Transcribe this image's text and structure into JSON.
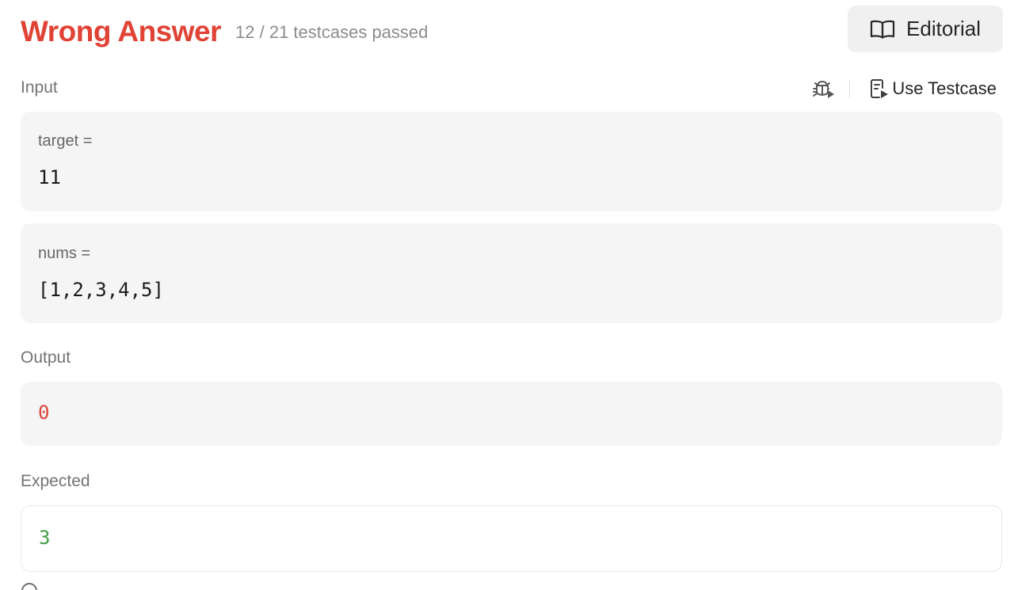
{
  "header": {
    "verdict": "Wrong Answer",
    "testcases_passed": "12 / 21 testcases passed",
    "editorial_label": "Editorial"
  },
  "colors": {
    "wrong": "#e04335",
    "expected": "#43a047",
    "output_error": "#d9453a"
  },
  "input": {
    "label": "Input",
    "use_testcase_label": "Use Testcase",
    "params": [
      {
        "name": "target =",
        "value": "11"
      },
      {
        "name": "nums =",
        "value": "[1,2,3,4,5]"
      }
    ]
  },
  "output": {
    "label": "Output",
    "value": "0"
  },
  "expected": {
    "label": "Expected",
    "value": "3"
  },
  "icons": {
    "editorial": "book-open-icon",
    "debug": "bug-play-icon",
    "use_testcase": "file-play-icon",
    "footer": "info-circle-icon"
  }
}
